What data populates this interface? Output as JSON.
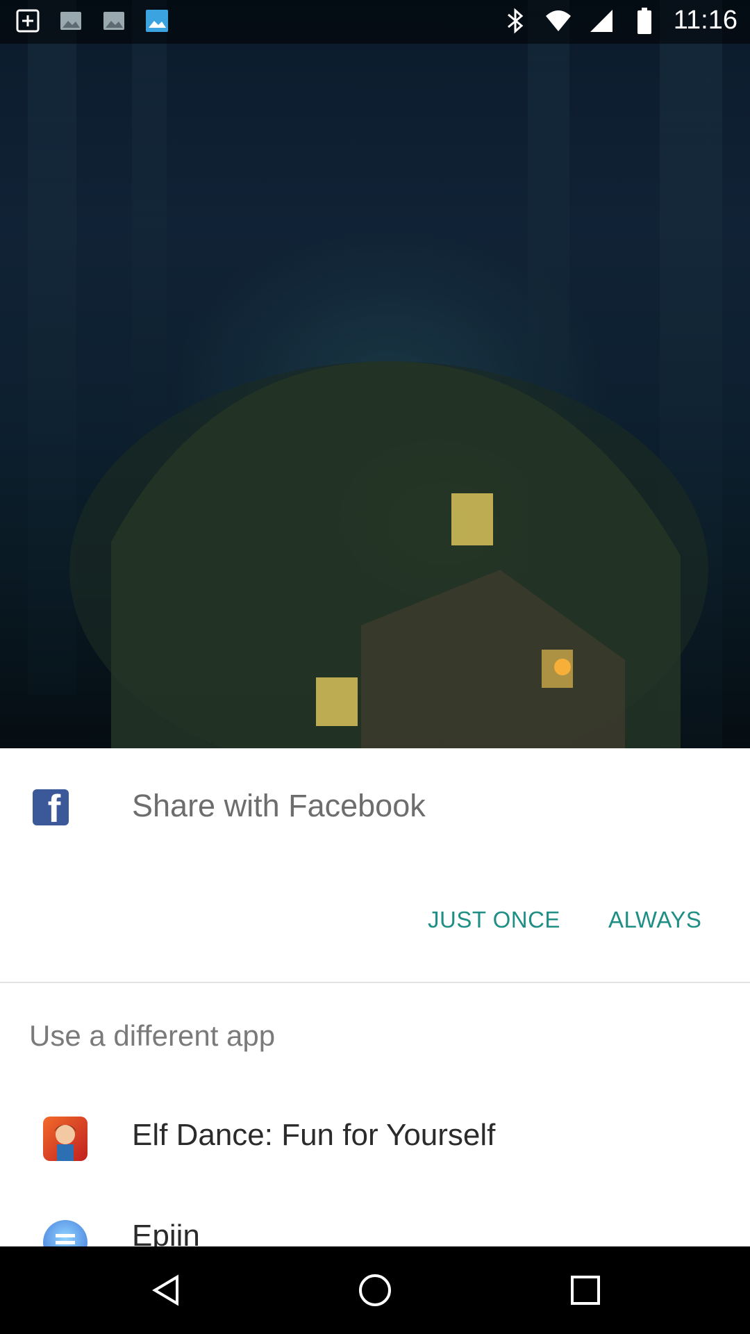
{
  "status_bar": {
    "time": "11:16",
    "icons": [
      "add-icon",
      "image-icon",
      "image-icon",
      "image-icon",
      "bluetooth-icon",
      "wifi-icon",
      "signal-icon",
      "battery-icon"
    ]
  },
  "share_dialog": {
    "title": "Share with Facebook",
    "app_icon": "facebook-icon",
    "just_once_label": "JUST ONCE",
    "always_label": "ALWAYS",
    "accent_color": "#1f8f86"
  },
  "alternatives": {
    "header": "Use a different app",
    "apps": [
      {
        "label": "Elf Dance: Fun for Yourself",
        "icon": "elf-dance-icon"
      },
      {
        "label": "Epiin",
        "icon": "epiin-icon"
      }
    ]
  },
  "nav_bar": {
    "icons": [
      "back-icon",
      "home-icon",
      "recents-icon"
    ]
  }
}
